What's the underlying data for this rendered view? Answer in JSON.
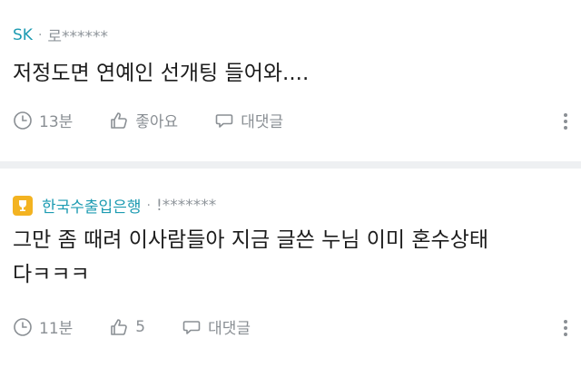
{
  "comments": [
    {
      "author": "SK",
      "separator": "·",
      "masked_id": "로******",
      "text": "저정도면 연예인 선개팅 들어와....",
      "time": "13분",
      "like_label": "좋아요",
      "reply_label": "대댓글"
    },
    {
      "author": "한국수출입은행",
      "separator": "·",
      "masked_id": "!*******",
      "text": "그만 좀 때려 이사람들아 지금 글쓴 누님 이미 혼수상태\n다ㅋㅋㅋ",
      "time": "11분",
      "like_label": "5",
      "reply_label": "대댓글",
      "badge_icon": "trophy-icon"
    }
  ],
  "colors": {
    "author": "#1d9bb2",
    "badge": "#f3b321",
    "muted": "#8a8f94",
    "separator_band": "#eef0f2"
  }
}
